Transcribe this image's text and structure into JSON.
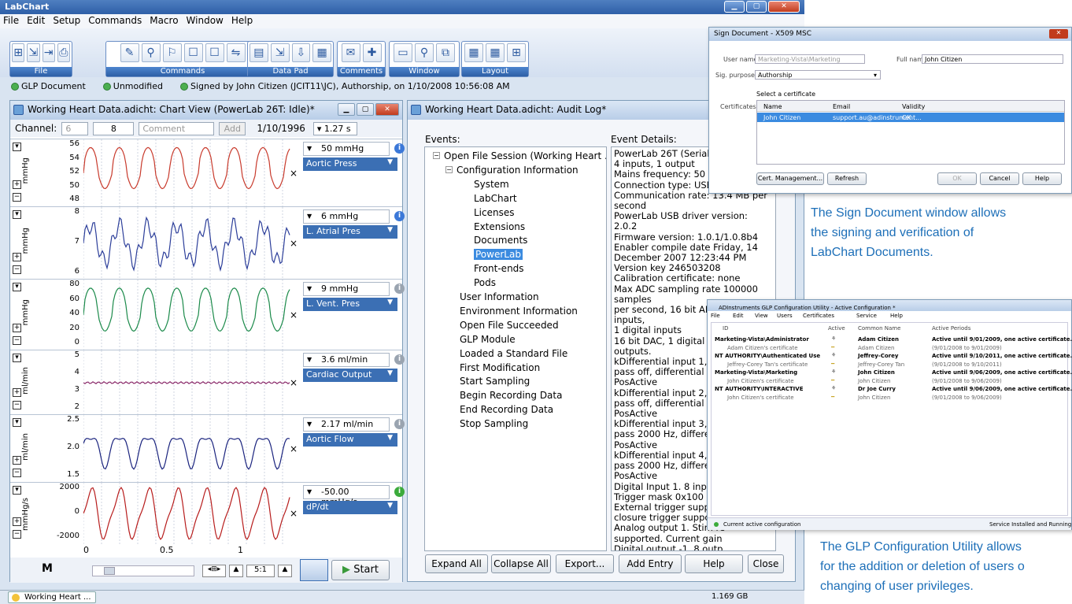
{
  "app": {
    "title": "LabChart",
    "menu": [
      "File",
      "Edit",
      "Setup",
      "Commands",
      "Macro",
      "Window",
      "Help"
    ],
    "toolbar_groups": [
      "File",
      "Commands",
      "Data Pad",
      "Comments",
      "Window",
      "Layout"
    ],
    "status": [
      "GLP Document",
      "Unmodified",
      "Signed by John Citizen (JCIT11\\JC), Authorship, on 1/10/2008 10:56:08 AM"
    ]
  },
  "chart": {
    "title": "Working Heart Data.adicht: Chart View (PowerLab 26T: Idle)*",
    "channel_label": "Channel:",
    "channel_value": "6",
    "channel_num": "8",
    "comment_placeholder": "Comment",
    "add_label": "Add",
    "date": "1/10/1996",
    "time_scale": "1.27 s",
    "channels": [
      {
        "unit": "mmHg",
        "ticks": [
          "56",
          "54",
          "52",
          "50",
          "48"
        ],
        "range": "50 mmHg",
        "name": "Aortic Press",
        "color": "#c83a2c",
        "info": "blue"
      },
      {
        "unit": "mmHg",
        "ticks": [
          "8",
          "7",
          "6"
        ],
        "range": "6 mmHg",
        "name": "L. Atrial Pres",
        "color": "#2c3e9a",
        "info": "blue"
      },
      {
        "unit": "mmHg",
        "ticks": [
          "80",
          "60",
          "40",
          "20",
          "0"
        ],
        "range": "9 mmHg",
        "name": "L. Vent. Pres",
        "color": "#1b8a4a",
        "info": "grey"
      },
      {
        "unit": "ml/min",
        "ticks": [
          "5",
          "4",
          "3",
          "2"
        ],
        "range": "3.6 ml/min",
        "name": "Cardiac Output",
        "color": "#8a2a6a",
        "info": "grey"
      },
      {
        "unit": "ml/min",
        "ticks": [
          "2.5",
          "2.0",
          "1.5"
        ],
        "range": "2.17 ml/min",
        "name": "Aortic Flow",
        "color": "#1a237e",
        "info": "grey"
      },
      {
        "unit": "mmHg/s",
        "ticks": [
          "2000",
          "0",
          "-2000"
        ],
        "range": "-50.00 mmHg/s",
        "name": "dP/dt",
        "color": "#b71c1c",
        "info": "green"
      }
    ],
    "time_ticks": [
      "0",
      "0.5",
      "1"
    ],
    "zoom": "5:1",
    "start_label": "Start"
  },
  "audit": {
    "title": "Working Heart Data.adicht: Audit Log*",
    "events_label": "Events:",
    "details_label": "Event Details:",
    "tree": [
      {
        "t": "Open File Session (Working Heart ...",
        "lvl": 0,
        "exp": "−"
      },
      {
        "t": "Configuration Information",
        "lvl": 1,
        "exp": "−"
      },
      {
        "t": "System",
        "lvl": 2
      },
      {
        "t": "LabChart",
        "lvl": 2
      },
      {
        "t": "Licenses",
        "lvl": 2
      },
      {
        "t": "Extensions",
        "lvl": 2
      },
      {
        "t": "Documents",
        "lvl": 2
      },
      {
        "t": "PowerLab",
        "lvl": 2,
        "sel": true
      },
      {
        "t": "Front-ends",
        "lvl": 2
      },
      {
        "t": "Pods",
        "lvl": 2
      },
      {
        "t": "User Information",
        "lvl": 1
      },
      {
        "t": "Environment Information",
        "lvl": 1
      },
      {
        "t": "Open File Succeeded",
        "lvl": 1
      },
      {
        "t": "GLP Module",
        "lvl": 1
      },
      {
        "t": "Loaded a Standard File",
        "lvl": 1
      },
      {
        "t": "First Modification",
        "lvl": 1
      },
      {
        "t": "Start Sampling",
        "lvl": 1
      },
      {
        "t": "Begin Recording Data",
        "lvl": 1
      },
      {
        "t": "End Recording Data",
        "lvl": 1
      },
      {
        "t": "Stop Sampling",
        "lvl": 1
      }
    ],
    "details": "PowerLab 26T (Serial No:\n4 inputs, 1 output\nMains frequency: 50 Hz\nConnection type: USB v2\nCommunication rate: 13.4 MB per\nsecond\nPowerLab USB driver version: 2.0.2\nFirmware version: 1.0.1/1.0.8b4\nEnabler compile date Friday, 14\nDecember 2007 12:23:44 PM\nVersion key 246503208\nCalibration certificate: none\nMax ADC sampling rate 100000 samples\nper second, 16 bit ADC, 4 analog inputs,\n1 digital inputs\n16 bit DAC, 1 digital outp\noutputs.\nkDifferential input 1, gain\npass off, differential DC\nPosActive\nkDifferential input 2, gain\npass off, differential DC\nPosActive\nkDifferential input 3, gain\npass 2000 Hz, differentia\nPosActive\nkDifferential input 4, gain\npass 2000 Hz, differentia\nPosActive\n Digital Input 1. 8 input b\nTrigger mask 0x100\nExternal trigger supporte\nclosure trigger supported\n Analog output 1. Stim re\nsupported. Current gain\n Digital output -1. 8 outp",
    "buttons": [
      "Expand All",
      "Collapse All",
      "Export...",
      "Add Entry",
      "Help",
      "Close"
    ]
  },
  "sign": {
    "title": "Sign Document - X509 MSC",
    "user_label": "User name:",
    "user_value": "Marketing-Vista\\Marketing",
    "full_label": "Full name:",
    "full_value": "John Citizen",
    "purpose_label": "Sig. purpose:",
    "purpose_value": "Authorship",
    "select_label": "Select a certificate",
    "cert_label": "Certificates:",
    "cols": [
      "Name",
      "Email",
      "Validity"
    ],
    "row": [
      "John Citizen",
      "support.au@adinstrument...",
      "OK"
    ],
    "buttons": [
      "Cert. Management...",
      "Refresh",
      "OK",
      "Cancel",
      "Help"
    ]
  },
  "captions": {
    "sign": [
      "The Sign Document window allows",
      "the signing and verification of",
      "LabChart Documents."
    ],
    "glp": [
      "The GLP Configuration Utility allows",
      "for the addition or deletion of users o",
      "changing of user privileges."
    ]
  },
  "glp": {
    "title": "ADInstruments GLP Configuration Utility - Active Configuration *",
    "menu": [
      "File",
      "Edit",
      "View",
      "Users",
      "Certificates",
      "Service",
      "Help"
    ],
    "cols": [
      "ID",
      "Active",
      "Common Name",
      "Active Periods"
    ],
    "rows": [
      {
        "id": "Marketing-Vista\\Administrator",
        "cn": "Adam Citizen",
        "ap": "Active until 9/01/2009, one active certificate.",
        "b": true
      },
      {
        "id": "Adam Citizen's certificate",
        "cn": "Adam Citizen",
        "ap": "(9/01/2008 to 9/01/2009)",
        "b": false
      },
      {
        "id": "NT AUTHORITY\\Authenticated Use",
        "cn": "Jeffrey-Corey",
        "ap": "Active until 9/10/2011, one active certificate.",
        "b": true
      },
      {
        "id": "Jeffrey-Corey Tan's certificate",
        "cn": "Jeffrey-Corey Tan",
        "ap": "(9/01/2008 to 9/10/2011)",
        "b": false
      },
      {
        "id": "Marketing-Vista\\Marketing",
        "cn": "John Citizen",
        "ap": "Active until 9/06/2009, one active certificate.",
        "b": true
      },
      {
        "id": "John Citizen's certificate",
        "cn": "John Citizen",
        "ap": "(9/01/2008 to 9/06/2009)",
        "b": false
      },
      {
        "id": "NT AUTHORITY\\INTERACTIVE",
        "cn": "Dr Joe Curry",
        "ap": "Active until 9/06/2009, one active certificate.",
        "b": true
      },
      {
        "id": "John Citizen's certificate",
        "cn": "John Citizen",
        "ap": "(9/01/2008 to 9/06/2009)",
        "b": false
      }
    ],
    "status_left": "Current active configuration",
    "status_right": "Service Installed and Running"
  },
  "taskbar": {
    "item": "Working Heart ...",
    "memory": "1.169 GB"
  }
}
